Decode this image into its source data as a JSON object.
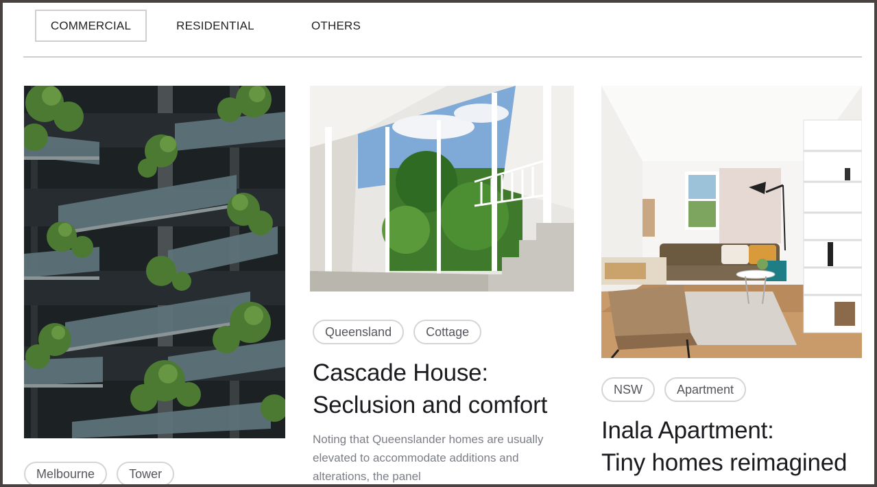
{
  "tabs": [
    {
      "label": "COMMERCIAL",
      "active": true
    },
    {
      "label": "RESIDENTIAL",
      "active": false
    },
    {
      "label": "OTHERS",
      "active": false
    }
  ],
  "cards": [
    {
      "tags": [
        "Melbourne",
        "Tower"
      ],
      "image": "vertical-forest-tower-photo"
    },
    {
      "tags": [
        "Queensland",
        "Cottage"
      ],
      "title_line1": "Cascade House:",
      "title_line2": "Seclusion and comfort",
      "description": "Noting that Queenslander homes are usually elevated to accommodate additions and alterations, the panel",
      "image": "cascade-house-courtyard-photo"
    },
    {
      "tags": [
        "NSW",
        "Apartment"
      ],
      "title_line1": "Inala Apartment:",
      "title_line2": "Tiny homes reimagined",
      "image": "inala-apartment-living-room-photo"
    }
  ],
  "colors": {
    "border": "#4a4241",
    "divider": "#cfcfcf",
    "tag_text": "#55565c",
    "title": "#1b1b1f",
    "description": "#7b7e87"
  }
}
